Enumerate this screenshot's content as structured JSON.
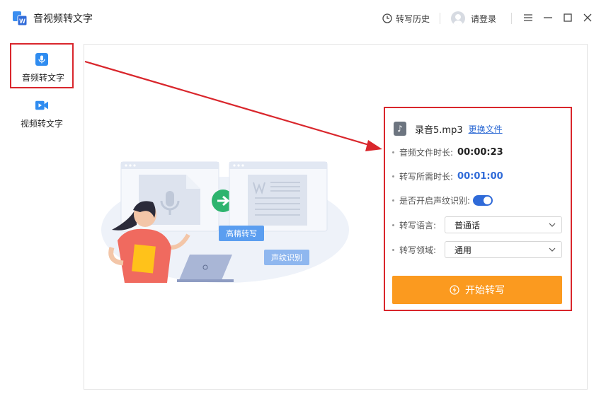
{
  "app": {
    "title": "音视频转文字"
  },
  "header": {
    "history_label": "转写历史",
    "login_label": "请登录"
  },
  "sidebar": {
    "items": [
      {
        "label": "音频转文字",
        "icon": "microphone-icon",
        "active": true
      },
      {
        "label": "视频转文字",
        "icon": "video-camera-icon",
        "active": false
      }
    ]
  },
  "illustration": {
    "bubble_hq": "高精转写",
    "bubble_voiceprint": "声纹识别"
  },
  "file": {
    "name": "录音5.mp3",
    "change_label": "更换文件",
    "icon": "music-note-icon"
  },
  "info": {
    "duration_label": "音频文件时长:",
    "duration_value": "00:00:23",
    "required_label": "转写所需时长:",
    "required_value": "00:01:00",
    "voiceprint_label": "是否开启声纹识别:",
    "voiceprint_enabled": true,
    "language_label": "转写语言:",
    "language_value": "普通话",
    "domain_label": "转写领域:",
    "domain_value": "通用"
  },
  "start_button": {
    "label": "开始转写"
  },
  "colors": {
    "accent_blue": "#2f6ad8",
    "highlight_red": "#d9262c",
    "start_orange": "#fb9a1f"
  }
}
